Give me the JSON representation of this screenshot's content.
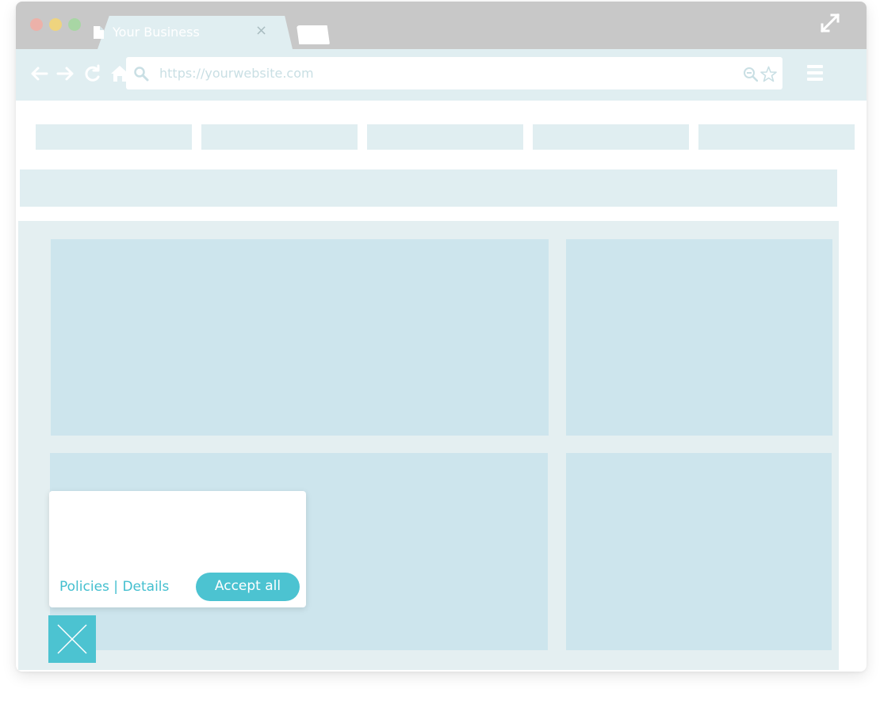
{
  "browser": {
    "tab_title": "Your Business",
    "tab_close_glyph": "×",
    "url": "https://yourwebsite.com",
    "icons": [
      "back-arrow-icon",
      "forward-arrow-icon",
      "reload-icon",
      "home-icon",
      "search-icon",
      "zoom-icon",
      "star-icon",
      "menu-icon",
      "expand-icon",
      "document-icon",
      "close-icon"
    ]
  },
  "cookie_banner": {
    "policies_link": "Policies",
    "separator": "|",
    "details_link": "Details",
    "accept_label": "Accept all"
  },
  "colors": {
    "accent": "#4cc3d1",
    "chrome_gray": "#c8c8c8",
    "toolbar_bg": "#e0eef1",
    "panel_bg": "#cde5ed",
    "content_bg": "#e4eff1"
  }
}
